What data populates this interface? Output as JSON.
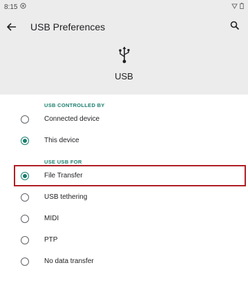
{
  "status_bar": {
    "time": "8:15"
  },
  "app_bar": {
    "title": "USB Preferences"
  },
  "hero": {
    "label": "USB"
  },
  "controlled_by": {
    "header": "USB CONTROLLED BY",
    "options": [
      {
        "label": "Connected device",
        "checked": false
      },
      {
        "label": "This device",
        "checked": true
      }
    ]
  },
  "use_for": {
    "header": "USE USB FOR",
    "options": [
      {
        "label": "File Transfer",
        "checked": true
      },
      {
        "label": "USB tethering",
        "checked": false
      },
      {
        "label": "MIDI",
        "checked": false
      },
      {
        "label": "PTP",
        "checked": false
      },
      {
        "label": "No data transfer",
        "checked": false
      }
    ]
  },
  "colors": {
    "accent": "#1a7f6e",
    "highlight": "#b01e23"
  }
}
